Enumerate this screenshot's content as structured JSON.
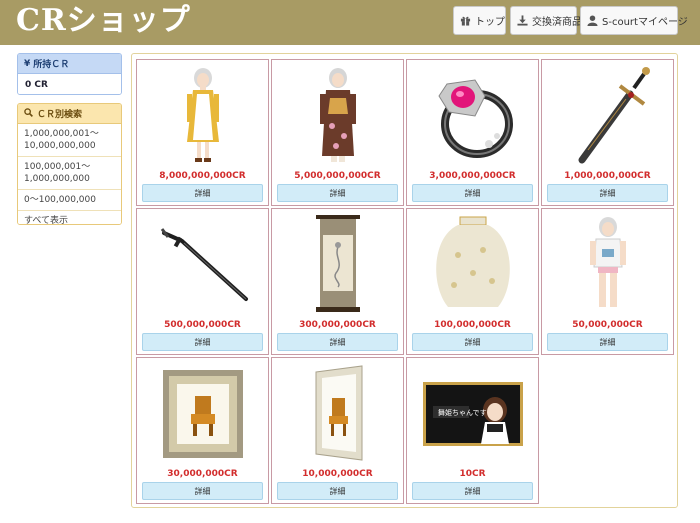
{
  "header": {
    "logo": "CRショップ",
    "nav": [
      {
        "label": "トップ",
        "icon": "gift-icon"
      },
      {
        "label": "交換済商品",
        "icon": "download-icon"
      },
      {
        "label": "S-courtマイページ",
        "icon": "user-icon"
      }
    ]
  },
  "sidebar": {
    "cr_panel": {
      "title": "所持ＣＲ",
      "icon": "yen-icon",
      "value": "0 CR"
    },
    "search_panel": {
      "title": "ＣＲ別検索",
      "icon": "search-icon",
      "ranges": [
        "1,000,000,001〜10,000,000,000",
        "100,000,001〜1,000,000,000",
        "0〜100,000,000",
        "すべて表示"
      ]
    }
  },
  "products": [
    {
      "price": "8,000,000,000CR",
      "image": "maid-dress-avatar"
    },
    {
      "price": "5,000,000,000CR",
      "image": "kimono-avatar"
    },
    {
      "price": "3,000,000,000CR",
      "image": "jeweled-ring"
    },
    {
      "price": "1,000,000,000CR",
      "image": "ornate-sword"
    },
    {
      "price": "500,000,000CR",
      "image": "katana"
    },
    {
      "price": "300,000,000CR",
      "image": "hanging-scroll"
    },
    {
      "price": "100,000,000CR",
      "image": "ceramic-vase"
    },
    {
      "price": "50,000,000CR",
      "image": "tshirt-avatar"
    },
    {
      "price": "30,000,000CR",
      "image": "framed-chair-painting"
    },
    {
      "price": "10,000,000CR",
      "image": "framed-chair-painting-small"
    },
    {
      "price": "10CR",
      "image": "anime-banner"
    }
  ],
  "detail_label": "詳細",
  "banner_text": "舞姫ちゃんです",
  "colors": {
    "header": "#a89b64",
    "price": "#d22d2d",
    "detail_button": "#d2ecf8"
  }
}
